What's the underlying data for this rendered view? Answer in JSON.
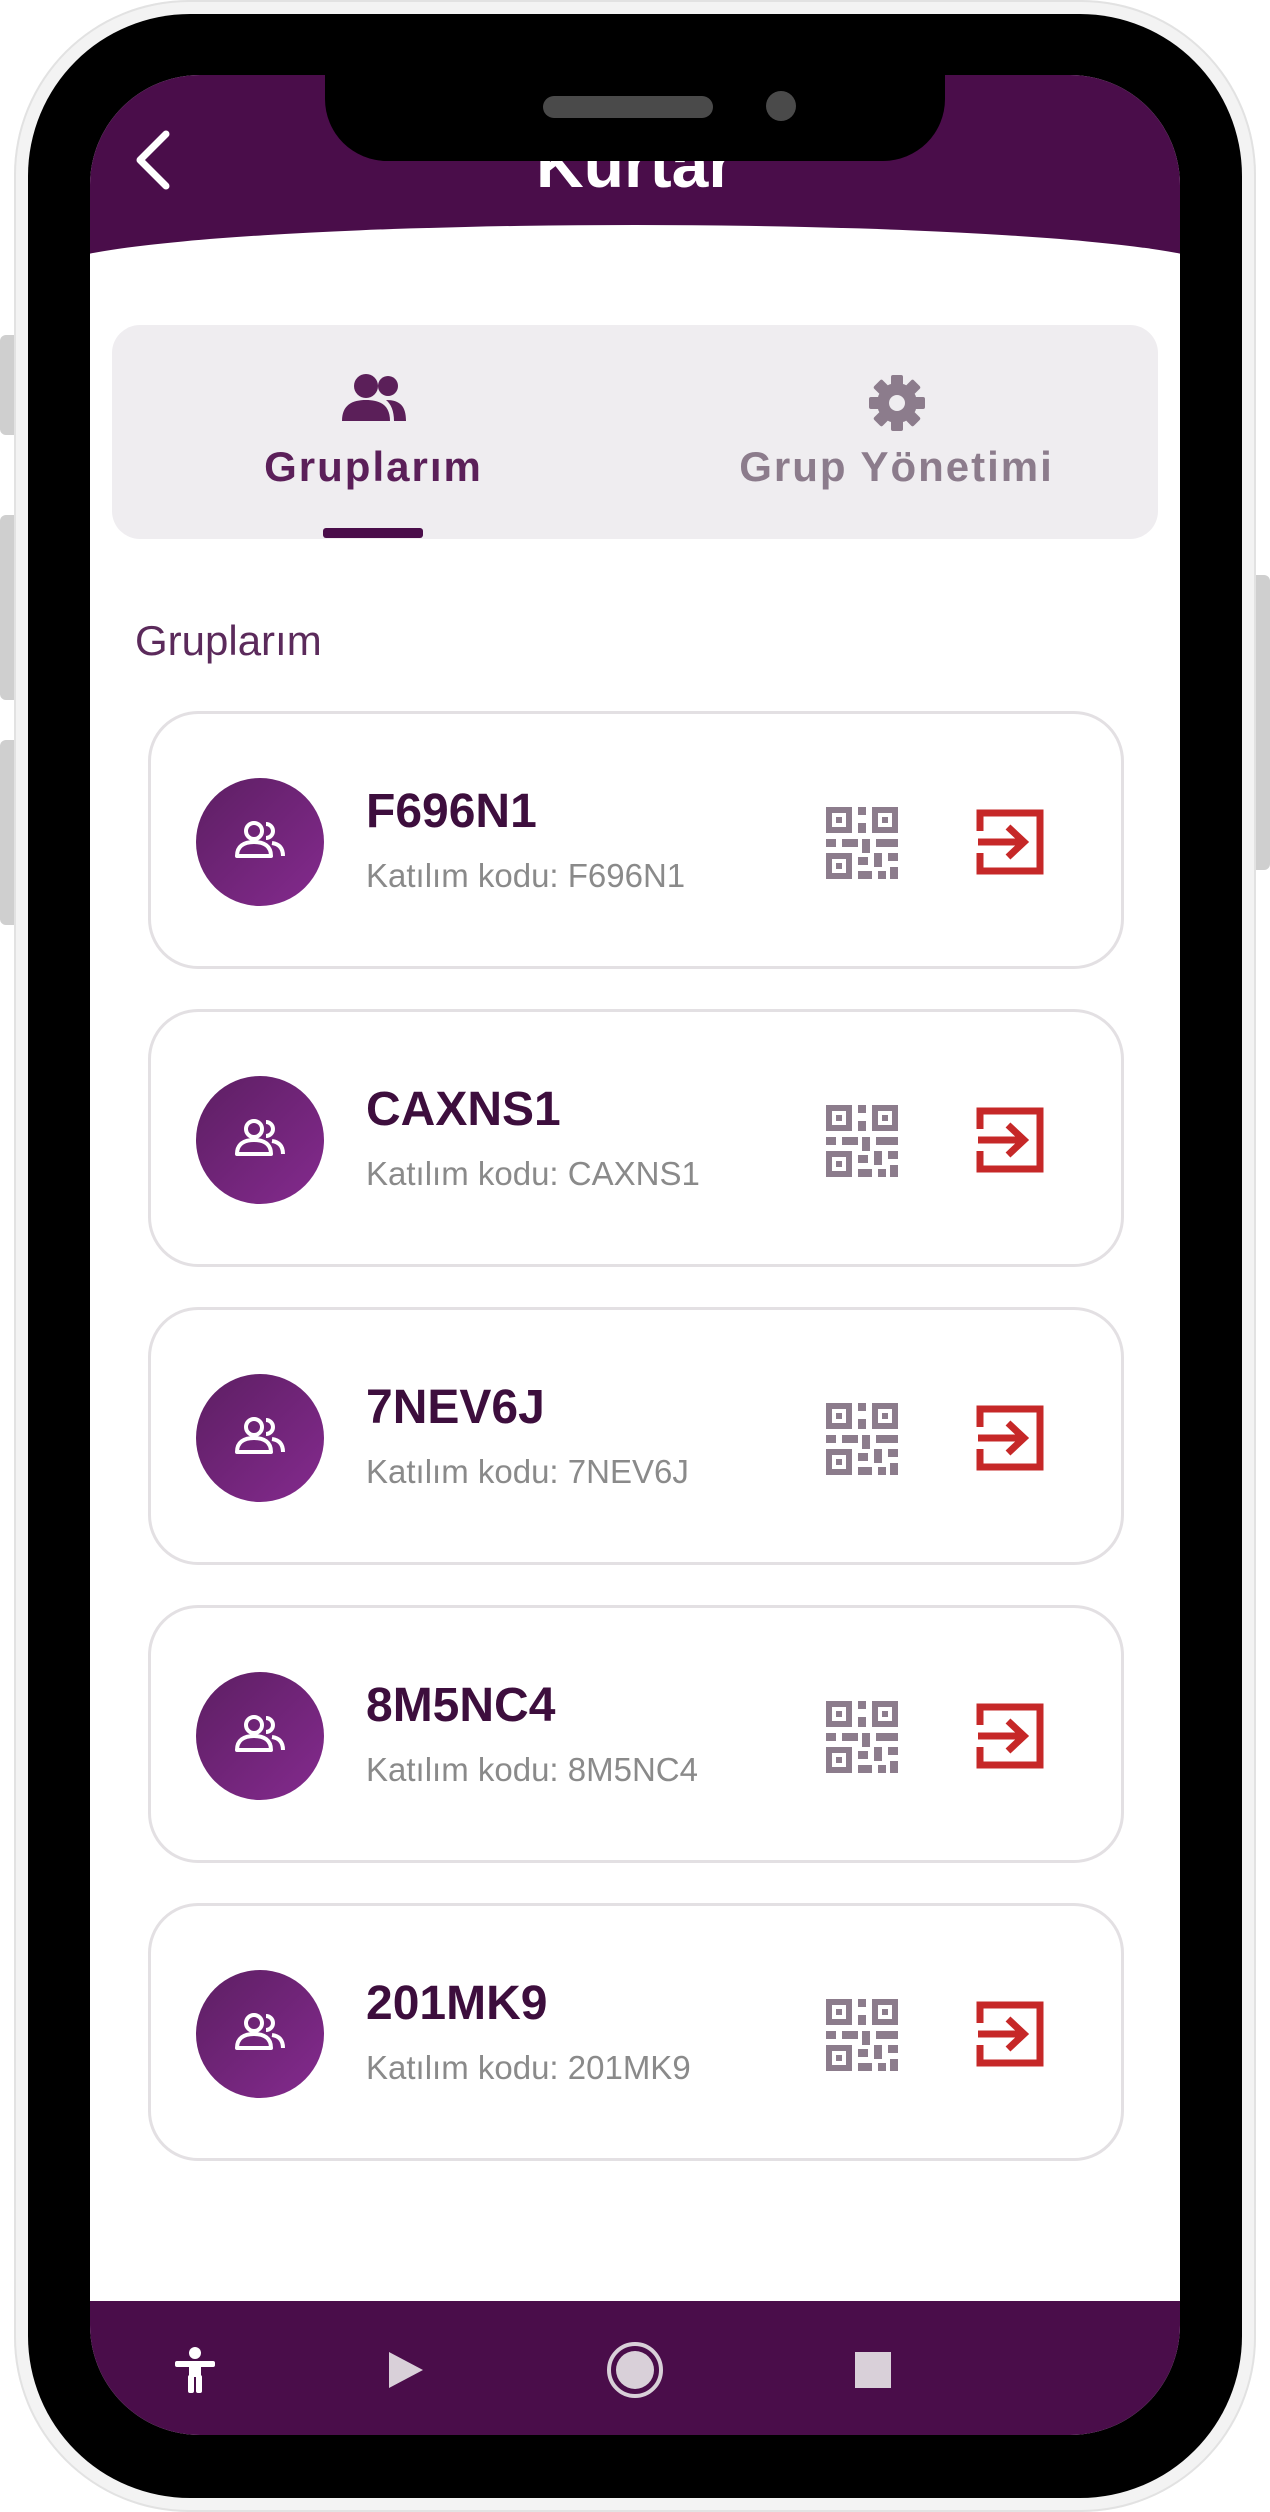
{
  "app": {
    "title": "Kurtar"
  },
  "tabs": [
    {
      "label": "Gruplarım",
      "icon": "group-icon",
      "active": true
    },
    {
      "label": "Grup Yönetimi",
      "icon": "gear-icon",
      "active": false
    }
  ],
  "section": {
    "title": "Gruplarım"
  },
  "groups": [
    {
      "name": "F696N1",
      "join_code": "Katılım kodu: F696N1"
    },
    {
      "name": "CAXNS1",
      "join_code": "Katılım kodu: CAXNS1"
    },
    {
      "name": "7NEV6J",
      "join_code": "Katılım kodu: 7NEV6J"
    },
    {
      "name": "8M5NC4",
      "join_code": "Katılım kodu: 8M5NC4"
    },
    {
      "name": "201MK9",
      "join_code": "Katılım kodu: 201MK9"
    }
  ],
  "navbar": [
    "accessibility-icon",
    "play-icon",
    "home-circle-icon",
    "stop-icon"
  ],
  "colors": {
    "primary": "#4a0d4a",
    "avatar_gradient_start": "#5d1f63",
    "avatar_gradient_end": "#842a8e",
    "join_icon": "#c62828",
    "qr_icon": "#8c7c8c"
  }
}
